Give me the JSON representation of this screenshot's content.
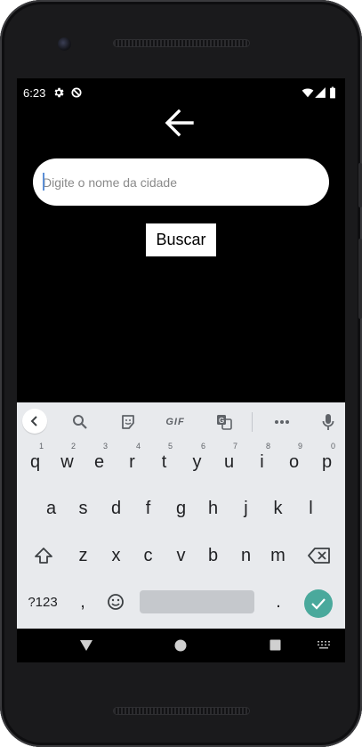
{
  "status_bar": {
    "time": "6:23",
    "icons": [
      "settings-icon",
      "data-saver-icon",
      "wifi-icon",
      "signal-icon",
      "battery-icon"
    ]
  },
  "app": {
    "back_icon": "arrow-left-icon",
    "city_input": {
      "placeholder": "Digite o nome da cidade",
      "value": ""
    },
    "search_button_label": "Buscar"
  },
  "keyboard": {
    "toolbar": [
      "collapse-icon",
      "search-icon",
      "sticker-icon",
      "GIF",
      "translate-icon",
      "more-icon",
      "mic-icon"
    ],
    "gif_label": "GIF",
    "row1": [
      {
        "key": "q",
        "hint": "1"
      },
      {
        "key": "w",
        "hint": "2"
      },
      {
        "key": "e",
        "hint": "3"
      },
      {
        "key": "r",
        "hint": "4"
      },
      {
        "key": "t",
        "hint": "5"
      },
      {
        "key": "y",
        "hint": "6"
      },
      {
        "key": "u",
        "hint": "7"
      },
      {
        "key": "i",
        "hint": "8"
      },
      {
        "key": "o",
        "hint": "9"
      },
      {
        "key": "p",
        "hint": "0"
      }
    ],
    "row2": [
      "a",
      "s",
      "d",
      "f",
      "g",
      "h",
      "j",
      "k",
      "l"
    ],
    "row3": [
      "z",
      "x",
      "c",
      "v",
      "b",
      "n",
      "m"
    ],
    "symbols_label": "?123",
    "comma_label": ",",
    "period_label": ".",
    "colors": {
      "accent": "#4aa99c",
      "background": "#e8eaed",
      "spacebar": "#c5c8cc"
    }
  },
  "nav_bar": {
    "icons": [
      "back-triangle-icon",
      "home-circle-icon",
      "recents-square-icon",
      "keyboard-switch-icon"
    ]
  }
}
